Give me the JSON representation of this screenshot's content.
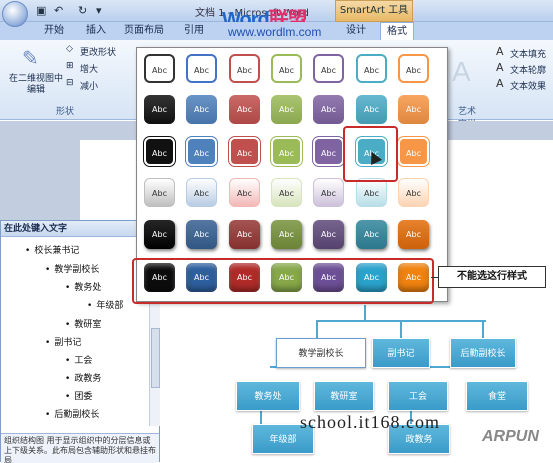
{
  "window": {
    "title": "文档 1 - Microsoft Word",
    "smartart_tools": "SmartArt 工具"
  },
  "watermarks": {
    "brand_word": "Word",
    "brand_cn": "联盟",
    "site": "www.wordlm.com",
    "school": "school.it168.com",
    "arpun": "ARPUN"
  },
  "tabs": [
    {
      "label": "开始"
    },
    {
      "label": "插入"
    },
    {
      "label": "页面布局"
    },
    {
      "label": "引用"
    },
    {
      "label": "设计"
    },
    {
      "label": "格式"
    }
  ],
  "ribbon": {
    "edit_2d": "在二维视图中编辑",
    "change_shape": "更改形状",
    "enlarge": "增大",
    "shrink": "减小",
    "group_shape": "形状",
    "text_fill": "文本填充",
    "text_outline": "文本轮廓",
    "text_effect": "文本效果",
    "group_art": "艺术字样式"
  },
  "gallery": {
    "swatch_label": "Abc",
    "rows": [
      {
        "style": "outline",
        "colors": [
          "#333333",
          "#4472c4",
          "#c0504d",
          "#9bbb59",
          "#8064a2",
          "#4bacc6",
          "#f79646"
        ]
      },
      {
        "style": "solid",
        "colors": [
          "#111111",
          "#4f81bd",
          "#c0504d",
          "#9bbb59",
          "#8064a2",
          "#4bacc6",
          "#f79646"
        ]
      },
      {
        "style": "subtle",
        "colors": [
          "#111111",
          "#4f81bd",
          "#c0504d",
          "#9bbb59",
          "#8064a2",
          "#4bacc6",
          "#f79646"
        ]
      },
      {
        "style": "light",
        "colors": [
          "#bfbfbf",
          "#b8cce4",
          "#f2b8b6",
          "#d7e4bd",
          "#ccc1da",
          "#b7dee8",
          "#fbd4b4"
        ]
      },
      {
        "style": "intense",
        "colors": [
          "#000000",
          "#366092",
          "#943634",
          "#76923c",
          "#5f497a",
          "#31859c",
          "#e36c09"
        ]
      },
      {
        "style": "bevel",
        "colors": [
          "#0d0d0d",
          "#2e5f9e",
          "#b02b28",
          "#87a84a",
          "#6d4f96",
          "#2aa3cc",
          "#f0820f"
        ]
      }
    ],
    "callout": "不能选这行样式"
  },
  "textpane": {
    "title": "在此处键入文字",
    "items": [
      {
        "text": "校长兼书记"
      },
      {
        "text": "教学副校长"
      },
      {
        "text": "教务处"
      },
      {
        "text": "年级部"
      },
      {
        "text": "教研室"
      },
      {
        "text": "副书记"
      },
      {
        "text": "工会"
      },
      {
        "text": "政教务"
      },
      {
        "text": "团委"
      },
      {
        "text": "后勤副校长"
      }
    ],
    "description": "组织结构图\n用于显示组织中的分层信息或上下级关系。此布局包含辅助形状和悬挂布局"
  },
  "chart_nodes": {
    "n1": "教学副校长",
    "n2": "副书记",
    "n3": "后勤副校长",
    "n4": "教务处",
    "n5": "教研室",
    "n6": "工会",
    "n7": "食堂",
    "n8": "年级部",
    "n9": "政教务"
  },
  "colors": {
    "accent": "#4bacc6",
    "highlight": "#c92a2a"
  }
}
